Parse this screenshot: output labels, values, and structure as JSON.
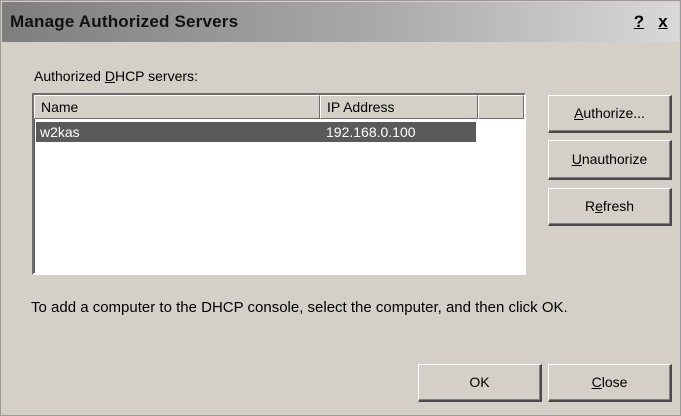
{
  "window": {
    "title": "Manage Authorized Servers",
    "help_glyph": "?",
    "close_glyph": "x"
  },
  "servers_label": {
    "before": "Authorized ",
    "mnemonic": "D",
    "after": "HCP servers:"
  },
  "list": {
    "columns": [
      "Name",
      "IP Address"
    ],
    "rows": [
      {
        "name": "w2kas",
        "ip": "192.168.0.100",
        "selected": true
      }
    ]
  },
  "buttons": {
    "authorize": {
      "mnemonic": "A",
      "rest": "uthorize..."
    },
    "unauthorize": {
      "mnemonic": "U",
      "rest": "nauthorize"
    },
    "refresh": {
      "pre": "R",
      "mnemonic": "e",
      "rest": "fresh"
    },
    "ok": "OK",
    "close": {
      "mnemonic": "C",
      "rest": "lose"
    }
  },
  "instruction": "To add a computer to the DHCP console, select the computer, and then click OK.",
  "colors": {
    "dialog_bg": "#d4d0c8",
    "selection_bg": "#5a5a5a",
    "selection_fg": "#ffffff"
  }
}
